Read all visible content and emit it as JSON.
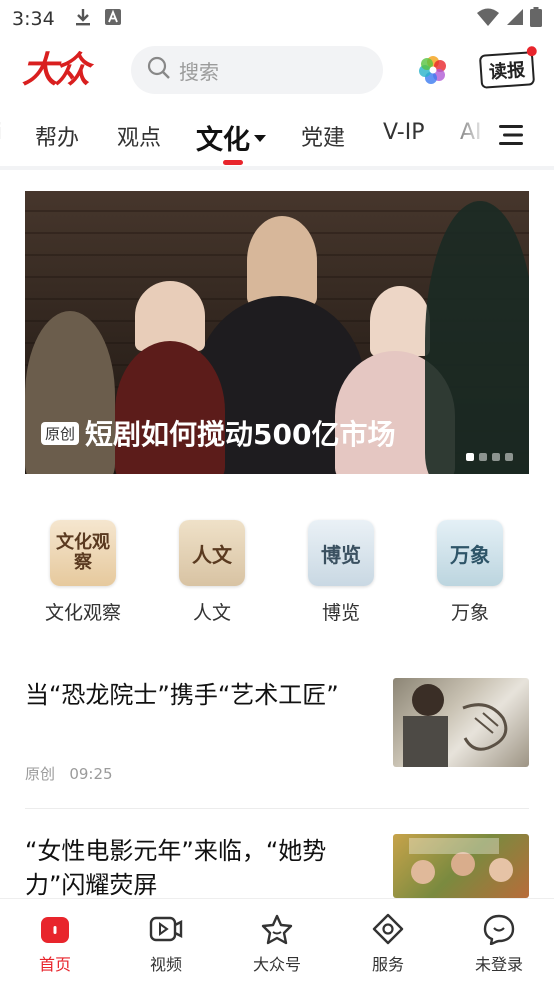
{
  "status_bar": {
    "time": "3:34"
  },
  "header": {
    "logo_text": "大众",
    "search_placeholder": "搜索",
    "read_paper_label": "读报"
  },
  "tabs": [
    {
      "label": "帮办"
    },
    {
      "label": "观点"
    },
    {
      "label": "文化",
      "active": true
    },
    {
      "label": "党建"
    },
    {
      "label": "V-IP"
    },
    {
      "label": "AI"
    }
  ],
  "banner": {
    "tag": "原创",
    "title": "短剧如何搅动500亿市场",
    "dots_total": 4,
    "dots_active": 1
  },
  "sub_channels": [
    {
      "label": "文化观察",
      "icon_text": "文化观察"
    },
    {
      "label": "人文",
      "icon_text": "人文"
    },
    {
      "label": "博览",
      "icon_text": "博览"
    },
    {
      "label": "万象",
      "icon_text": "万象"
    }
  ],
  "news": [
    {
      "title": "当“恐龙院士”携手“艺术工匠”",
      "source": "原创",
      "time": "09:25"
    },
    {
      "title": "“女性电影元年”来临，“她势力”闪耀荧屏"
    }
  ],
  "bottom_nav": [
    {
      "label": "首页",
      "icon": "home-icon",
      "active": true
    },
    {
      "label": "视频",
      "icon": "video-icon"
    },
    {
      "label": "大众号",
      "icon": "star-icon"
    },
    {
      "label": "服务",
      "icon": "service-icon"
    },
    {
      "label": "未登录",
      "icon": "user-icon"
    }
  ],
  "colors": {
    "accent": "#e8252c",
    "brand": "#d91f1f"
  }
}
